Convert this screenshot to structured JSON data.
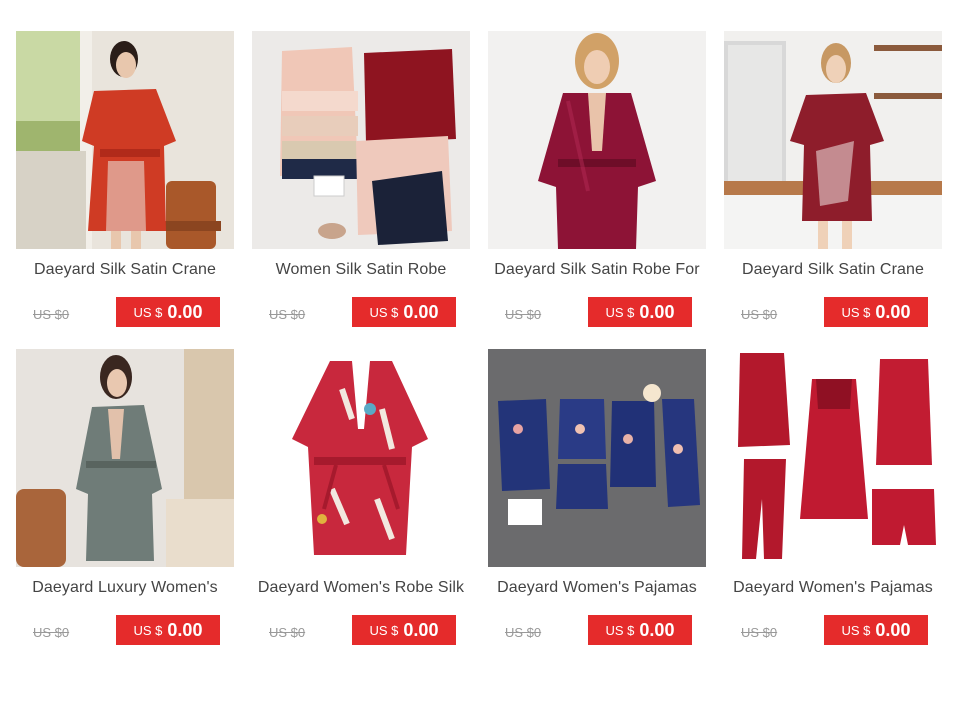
{
  "colors": {
    "price_badge_bg": "#e52b2b",
    "price_badge_text": "#ffffff",
    "title_text": "#444444",
    "old_price_text": "#999999"
  },
  "products": [
    {
      "title": "Daeyard Silk Satin Crane",
      "old_price": "US $0",
      "currency": "US $",
      "price": "0.00",
      "image": "red-crane-kimono-photo"
    },
    {
      "title": "Women Silk Satin Robe",
      "old_price": "US $0",
      "currency": "US $",
      "price": "0.00",
      "image": "bride-robes-flatlay-photo"
    },
    {
      "title": "Daeyard Silk Satin Robe For",
      "old_price": "US $0",
      "currency": "US $",
      "price": "0.00",
      "image": "burgundy-satin-robe-photo"
    },
    {
      "title": "Daeyard Silk Satin Crane",
      "old_price": "US $0",
      "currency": "US $",
      "price": "0.00",
      "image": "kitchen-crane-robe-photo"
    },
    {
      "title": "Daeyard Luxury Women's",
      "old_price": "US $0",
      "currency": "US $",
      "price": "0.00",
      "image": "grey-robe-photo"
    },
    {
      "title": "Daeyard Women's Robe Silk",
      "old_price": "US $0",
      "currency": "US $",
      "price": "0.00",
      "image": "floral-crane-robe-photo"
    },
    {
      "title": "Daeyard Women's Pajamas",
      "old_price": "US $0",
      "currency": "US $",
      "price": "0.00",
      "image": "navy-floral-pajama-set-photo"
    },
    {
      "title": "Daeyard Women's Pajamas",
      "old_price": "US $0",
      "currency": "US $",
      "price": "0.00",
      "image": "red-satin-pajama-set-photo"
    }
  ]
}
